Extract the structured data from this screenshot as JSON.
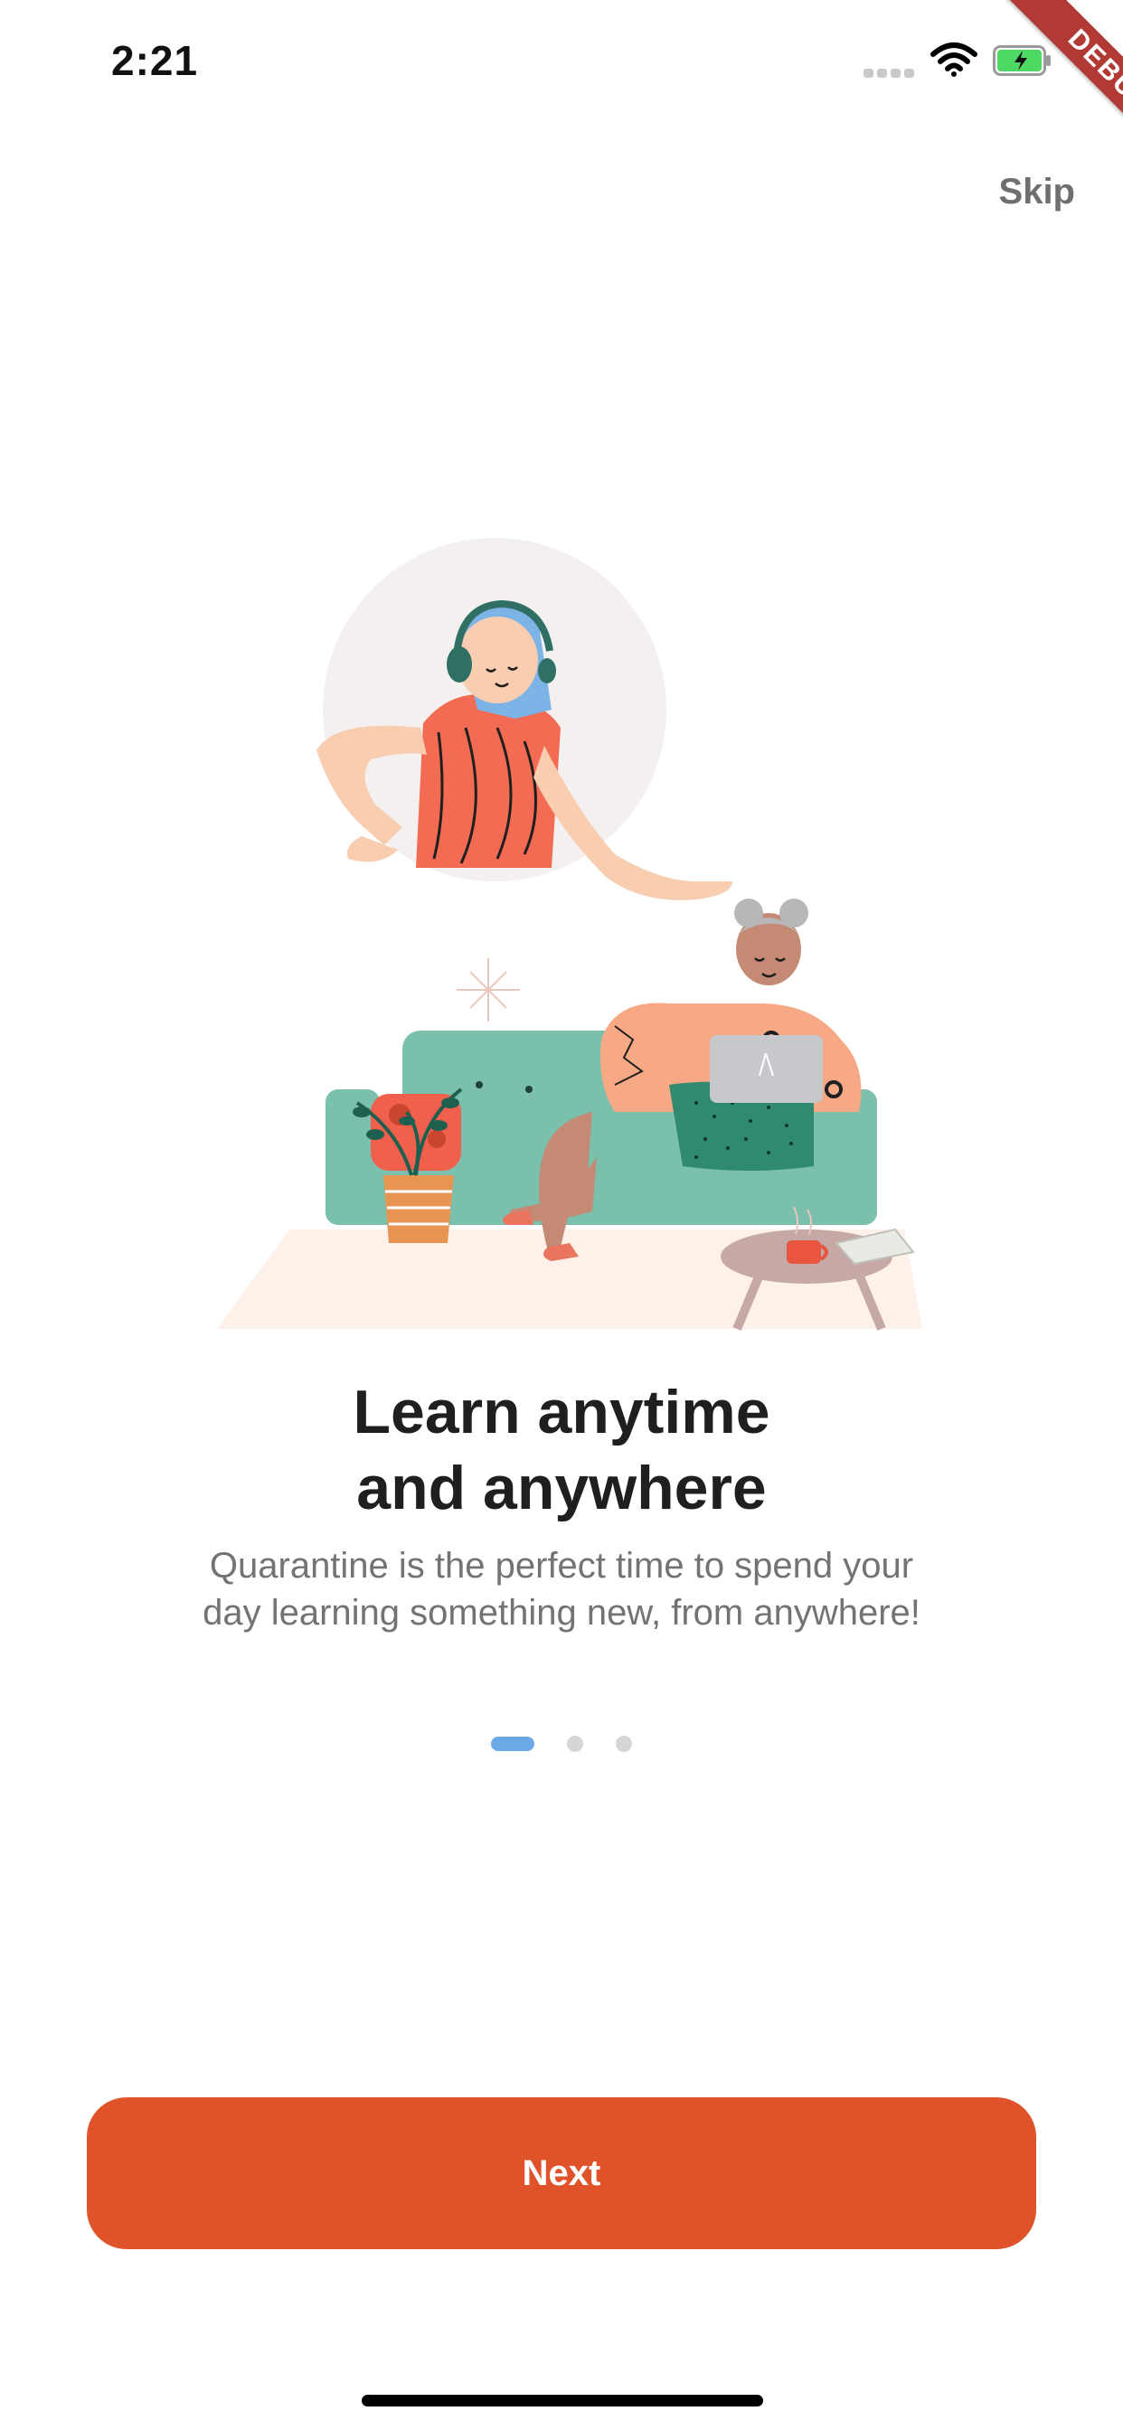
{
  "status_bar": {
    "time": "2:21",
    "icons": [
      "signal-icon",
      "wifi-icon",
      "battery-charging-icon"
    ]
  },
  "debug_banner": {
    "label": "DEBUG",
    "color": "#b23a35"
  },
  "header": {
    "skip_label": "Skip"
  },
  "onboarding": {
    "illustration": "person-on-couch-with-laptop-illustration",
    "title_line1": "Learn anytime",
    "title_line2": "and anywhere",
    "subtitle_line1": "Quarantine is the perfect time to spend your",
    "subtitle_line2": "day learning something new, from anywhere!",
    "page_indicator": {
      "current_page": 1,
      "total_pages": 3
    }
  },
  "footer": {
    "next_label": "Next"
  },
  "colors": {
    "accent": "#e0532a",
    "indicator_active": "#6aa8e6",
    "indicator_inactive": "#d6d6d6",
    "title": "#1f1f1f",
    "subtitle": "#737373"
  }
}
